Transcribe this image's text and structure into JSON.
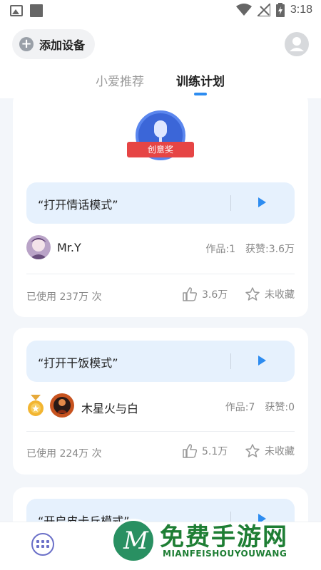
{
  "statusbar": {
    "time": "3:18"
  },
  "header": {
    "add_device_label": "添加设备"
  },
  "tabs": [
    {
      "label": "小爱推荐",
      "active": false
    },
    {
      "label": "训练计划",
      "active": true
    }
  ],
  "cards": [
    {
      "badge": "创意奖",
      "command": "“打开情话模式”",
      "author": "Mr.Y",
      "works": "作品:1",
      "likes_received": "获赞:3.6万",
      "usage": "已使用 237万 次",
      "likes": "3.6万",
      "favorite": "未收藏"
    },
    {
      "command": "“打开干饭模式”",
      "author": "木星火与白",
      "works": "作品:7",
      "likes_received": "获赞:0",
      "usage": "已使用 224万 次",
      "likes": "5.1万",
      "favorite": "未收藏"
    },
    {
      "command": "“开启皮卡丘模式”"
    }
  ],
  "watermark": {
    "cn": "免费手游网",
    "en": "MIANFEISHOUYOUWANG"
  },
  "colors": {
    "accent": "#2d8cf0",
    "command_bg": "#e6f1fd",
    "page_bg": "#f3f6fa"
  }
}
